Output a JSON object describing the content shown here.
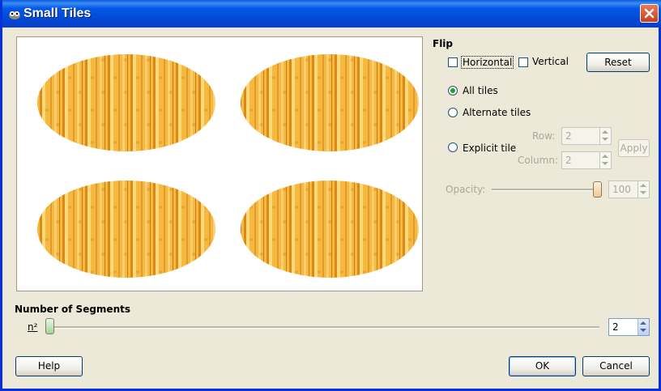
{
  "window": {
    "title": "Small Tiles"
  },
  "flip": {
    "section_label": "Flip",
    "horizontal_label": "Horizontal",
    "horizontal_checked": false,
    "vertical_label": "Vertical",
    "vertical_checked": false,
    "reset_label": "Reset"
  },
  "tiles_mode": {
    "options": [
      "All tiles",
      "Alternate tiles",
      "Explicit tile"
    ],
    "selected": "All tiles"
  },
  "explicit": {
    "row_label": "Row:",
    "row_value": "2",
    "column_label": "Column:",
    "column_value": "2",
    "apply_label": "Apply"
  },
  "opacity": {
    "label": "Opacity:",
    "value": "100",
    "fraction": 1.0
  },
  "segments": {
    "section_label": "Number of Segments",
    "label": "n²",
    "value": "2",
    "fraction": 0.0
  },
  "buttons": {
    "help": "Help",
    "ok": "OK",
    "cancel": "Cancel"
  },
  "colors": {
    "titlebar": "#0054E3",
    "tile_fill": "#F5B942",
    "dialog_bg": "#ECE9D8"
  }
}
